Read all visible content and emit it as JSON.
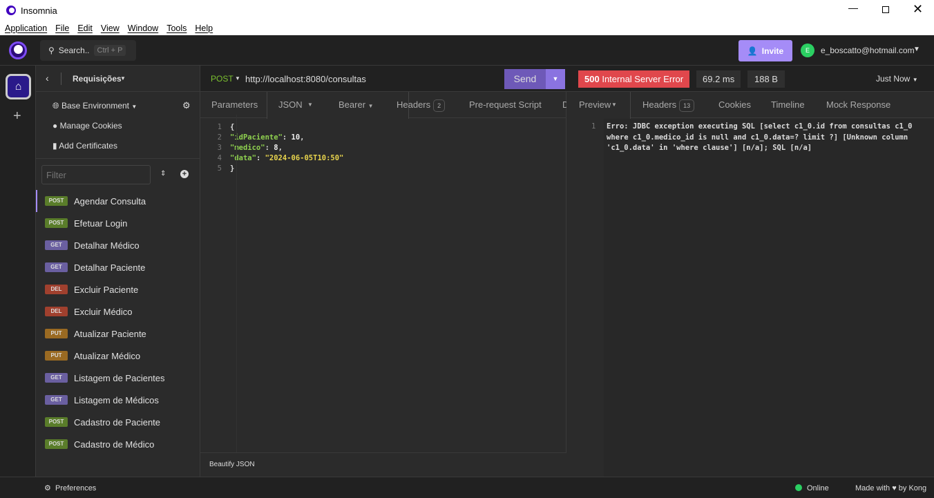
{
  "window": {
    "title": "Insomnia",
    "menu": [
      "Application",
      "File",
      "Edit",
      "View",
      "Window",
      "Tools",
      "Help"
    ]
  },
  "header": {
    "search_label": "Search..",
    "search_shortcut": "Ctrl + P",
    "invite_label": "Invite",
    "avatar_initial": "E",
    "user_email": "e_boscatto@hotmail.com"
  },
  "sidebar": {
    "collection_name": "Requisições",
    "environment": "Base Environment",
    "manage_cookies": "Manage Cookies",
    "add_certificates": "Add Certificates",
    "filter_placeholder": "Filter",
    "items": [
      {
        "method": "POST",
        "name": "Agendar Consulta",
        "active": true
      },
      {
        "method": "POST",
        "name": "Efetuar Login"
      },
      {
        "method": "GET",
        "name": "Detalhar Médico"
      },
      {
        "method": "GET",
        "name": "Detalhar Paciente"
      },
      {
        "method": "DEL",
        "name": "Excluir Paciente"
      },
      {
        "method": "DEL",
        "name": "Excluir Médico"
      },
      {
        "method": "PUT",
        "name": "Atualizar Paciente"
      },
      {
        "method": "PUT",
        "name": "Atualizar Médico"
      },
      {
        "method": "GET",
        "name": "Listagem de Pacientes"
      },
      {
        "method": "GET",
        "name": "Listagem de Médicos"
      },
      {
        "method": "POST",
        "name": "Cadastro de Paciente"
      },
      {
        "method": "POST",
        "name": "Cadastro de Médico"
      }
    ]
  },
  "method_colors": {
    "POST": "#5a7d2a",
    "GET": "#6a5fa0",
    "DEL": "#a0402e",
    "PUT": "#9a6a22"
  },
  "request": {
    "method": "POST",
    "url": "http://localhost:8080/consultas",
    "send_label": "Send",
    "tabs": {
      "parameters": "Parameters",
      "body": "JSON",
      "auth": "Bearer",
      "headers": "Headers",
      "headers_count": "2",
      "prerequest": "Pre-request Script",
      "docs": "D"
    },
    "body_lines": [
      [
        {
          "t": "{",
          "c": "#ddd"
        }
      ],
      [
        {
          "t": "\"idPaciente\"",
          "c": "#8fd14f"
        },
        {
          "t": ": ",
          "c": "#ddd"
        },
        {
          "t": "10",
          "c": "#eee"
        },
        {
          "t": ",",
          "c": "#ddd"
        }
      ],
      [
        {
          "t": "\"medico\"",
          "c": "#8fd14f"
        },
        {
          "t": ": ",
          "c": "#ddd"
        },
        {
          "t": "8",
          "c": "#eee"
        },
        {
          "t": ",",
          "c": "#ddd"
        }
      ],
      [
        {
          "t": "\"data\"",
          "c": "#8fd14f"
        },
        {
          "t": ": ",
          "c": "#ddd"
        },
        {
          "t": "\"2024-06-05T10:50\"",
          "c": "#e8d44d"
        }
      ],
      [
        {
          "t": "}",
          "c": "#ddd"
        }
      ]
    ],
    "beautify_label": "Beautify JSON"
  },
  "response": {
    "status_code": "500",
    "status_text": "Internal Server Error",
    "status_color": "#e0474c",
    "time": "69.2 ms",
    "size": "188 B",
    "when": "Just Now",
    "tabs": {
      "preview": "Preview",
      "headers": "Headers",
      "headers_count": "13",
      "cookies": "Cookies",
      "timeline": "Timeline",
      "mock": "Mock Response"
    },
    "body_lines": [
      "Erro: JDBC exception executing SQL [select c1_0.id from consultas c1_0",
      "where c1_0.medico_id is null and c1_0.data=? limit ?] [Unknown column",
      "'c1_0.data' in 'where clause'] [n/a]; SQL [n/a]"
    ]
  },
  "footer": {
    "preferences": "Preferences",
    "online": "Online",
    "made_with": "Made with",
    "by_kong": "by Kong"
  }
}
